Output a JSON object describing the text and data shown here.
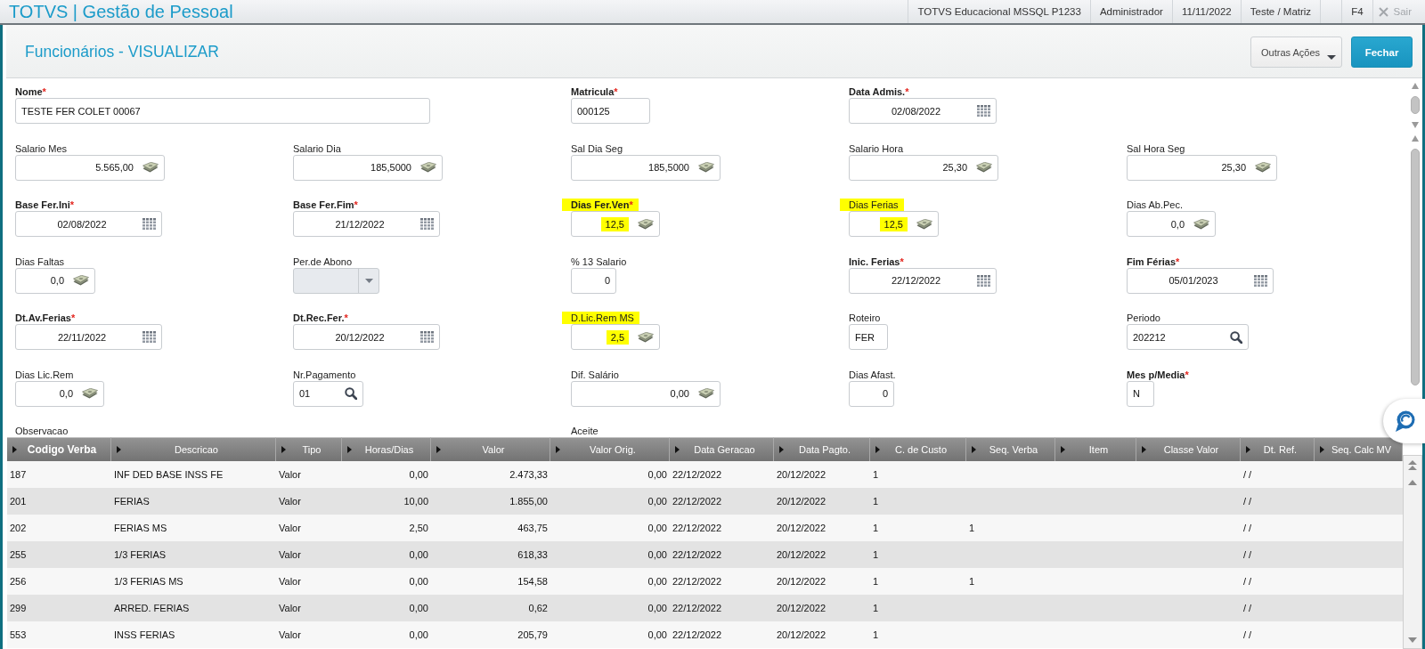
{
  "app_bar": {
    "title": "TOTVS | Gestão de Pessoal",
    "context": [
      "TOTVS Educacional MSSQL P1233",
      "Administrador",
      "11/11/2022",
      "Teste / Matriz"
    ],
    "shortcut": "F4",
    "exit": {
      "label": "Sair",
      "disabled": true
    }
  },
  "page": {
    "title": "Funcionários - VISUALIZAR",
    "buttons": [
      {
        "label": "Outras Ações",
        "kind": "menu"
      },
      {
        "label": "Fechar",
        "kind": "primary"
      }
    ]
  },
  "form": {
    "rows": [
      {
        "fields": [
          {
            "label": "Nome",
            "required": true,
            "mark": "*",
            "highlighted": false,
            "kind": "text",
            "value": "TESTE FER COLET 00067"
          },
          {
            "label": "Matricula",
            "required": true,
            "mark": "*",
            "highlighted": false,
            "kind": "text",
            "value": "000125"
          },
          {
            "label": "Data Admis.",
            "required": true,
            "mark": "*",
            "highlighted": false,
            "kind": "date",
            "value": "02/08/2022"
          }
        ]
      },
      {
        "fields": [
          {
            "label": "Salario Mes",
            "required": false,
            "highlighted": false,
            "kind": "currency",
            "value": "5.565,00"
          },
          {
            "label": "Salario Dia",
            "required": false,
            "highlighted": false,
            "kind": "currency",
            "value": "185,5000"
          },
          {
            "label": "Sal Dia Seg",
            "required": false,
            "highlighted": false,
            "kind": "currency",
            "value": "185,5000"
          },
          {
            "label": "Salario Hora",
            "required": false,
            "highlighted": false,
            "kind": "currency",
            "value": "25,30"
          },
          {
            "label": "Sal Hora Seg",
            "required": false,
            "highlighted": false,
            "kind": "currency",
            "value": "25,30"
          }
        ]
      },
      {
        "fields": [
          {
            "label": "Base Fer.Ini",
            "required": true,
            "mark": "*",
            "highlighted": false,
            "kind": "date",
            "value": "02/08/2022"
          },
          {
            "label": "Base Fer.Fim",
            "required": true,
            "mark": "*",
            "highlighted": false,
            "kind": "date",
            "value": "21/12/2022"
          },
          {
            "label": "Dias Fer.Ven",
            "required": true,
            "mark": "*",
            "highlighted": true,
            "kind": "currency",
            "value": "12,5"
          },
          {
            "label": "Dias Ferias",
            "required": false,
            "highlighted": true,
            "kind": "currency",
            "value": "12,5"
          },
          {
            "label": "Dias Ab.Pec.",
            "required": false,
            "highlighted": false,
            "kind": "currency",
            "value": "0,0"
          }
        ]
      },
      {
        "fields": [
          {
            "label": "Dias Faltas",
            "required": false,
            "highlighted": false,
            "kind": "currency",
            "value": "0,0"
          },
          {
            "label": "Per.de Abono",
            "required": false,
            "highlighted": false,
            "kind": "select"
          },
          {
            "label": "% 13 Salario",
            "required": false,
            "highlighted": false,
            "kind": "number",
            "value": "0"
          },
          {
            "label": "Inic. Ferias",
            "required": true,
            "mark": "*",
            "highlighted": false,
            "kind": "date",
            "value": "22/12/2022"
          },
          {
            "label": "Fim Férias",
            "required": true,
            "mark": "*",
            "highlighted": false,
            "kind": "date",
            "value": "05/01/2023"
          }
        ]
      },
      {
        "fields": [
          {
            "label": "Dt.Av.Ferias",
            "required": true,
            "mark": "*",
            "highlighted": false,
            "kind": "date",
            "value": "22/11/2022"
          },
          {
            "label": "Dt.Rec.Fer.",
            "required": true,
            "mark": "*",
            "highlighted": false,
            "kind": "date",
            "value": "20/12/2022"
          },
          {
            "label": "D.Lic.Rem MS",
            "required": false,
            "highlighted": true,
            "kind": "currency",
            "value": "2,5"
          },
          {
            "label": "Roteiro",
            "required": false,
            "highlighted": false,
            "kind": "text",
            "value": "FER"
          },
          {
            "label": "Periodo",
            "required": false,
            "highlighted": false,
            "kind": "lookup",
            "value": "202212"
          }
        ]
      },
      {
        "fields": [
          {
            "label": "Dias Lic.Rem",
            "required": false,
            "highlighted": false,
            "kind": "currency",
            "value": "0,0"
          },
          {
            "label": "Nr.Pagamento",
            "required": false,
            "highlighted": false,
            "kind": "lookup",
            "value": "01"
          },
          {
            "label": "Dif. Salário",
            "required": false,
            "highlighted": false,
            "kind": "currency",
            "value": "0,00"
          },
          {
            "label": "Dias Afast.",
            "required": false,
            "highlighted": false,
            "kind": "number",
            "value": "0"
          },
          {
            "label": "Mes p/Media",
            "required": true,
            "mark": "*",
            "highlighted": false,
            "kind": "text",
            "value": "N"
          }
        ]
      },
      {
        "fields": [
          {
            "label": "Observacao",
            "required": false,
            "highlighted": false,
            "kind": "memo"
          },
          {
            "label": "Aceite",
            "required": false,
            "highlighted": false,
            "kind": "memo"
          }
        ]
      }
    ]
  },
  "grid": {
    "columns": [
      {
        "label": "Codigo Verba",
        "sorted": true
      },
      {
        "label": "Descricao",
        "sorted": false
      },
      {
        "label": "Tipo",
        "sorted": false
      },
      {
        "label": "Horas/Dias",
        "sorted": false
      },
      {
        "label": "Valor",
        "sorted": false
      },
      {
        "label": "Valor Orig.",
        "sorted": false
      },
      {
        "label": "Data Geracao",
        "sorted": false
      },
      {
        "label": "Data Pagto.",
        "sorted": false
      },
      {
        "label": "C. de Custo",
        "sorted": false
      },
      {
        "label": "Seq. Verba",
        "sorted": false
      },
      {
        "label": "Item",
        "sorted": false
      },
      {
        "label": "Classe Valor",
        "sorted": false
      },
      {
        "label": "Dt. Ref.",
        "sorted": false
      },
      {
        "label": "Seq. Calc MV",
        "sorted": false
      }
    ],
    "rows": [
      [
        "187",
        "INF DED BASE INSS FE",
        "Valor",
        "0,00",
        "2.473,33",
        "0,00",
        "22/12/2022",
        "20/12/2022",
        "1",
        null,
        null,
        null,
        "/ /",
        null
      ],
      [
        "201",
        "FERIAS",
        "Valor",
        "10,00",
        "1.855,00",
        "0,00",
        "22/12/2022",
        "20/12/2022",
        "1",
        null,
        null,
        null,
        "/ /",
        null
      ],
      [
        "202",
        "FERIAS MS",
        "Valor",
        "2,50",
        "463,75",
        "0,00",
        "22/12/2022",
        "20/12/2022",
        "1",
        "1",
        null,
        null,
        "/ /",
        null
      ],
      [
        "255",
        "1/3 FERIAS",
        "Valor",
        "0,00",
        "618,33",
        "0,00",
        "22/12/2022",
        "20/12/2022",
        "1",
        null,
        null,
        null,
        "/ /",
        null
      ],
      [
        "256",
        "1/3 FERIAS MS",
        "Valor",
        "0,00",
        "154,58",
        "0,00",
        "22/12/2022",
        "20/12/2022",
        "1",
        "1",
        null,
        null,
        "/ /",
        null
      ],
      [
        "299",
        "ARRED. FERIAS",
        "Valor",
        "0,00",
        "0,62",
        "0,00",
        "22/12/2022",
        "20/12/2022",
        "1",
        null,
        null,
        null,
        "/ /",
        null
      ],
      [
        "553",
        "INSS FERIAS",
        "Valor",
        "0,00",
        "205,79",
        "0,00",
        "22/12/2022",
        "20/12/2022",
        "1",
        null,
        null,
        null,
        "/ /",
        null
      ]
    ]
  }
}
